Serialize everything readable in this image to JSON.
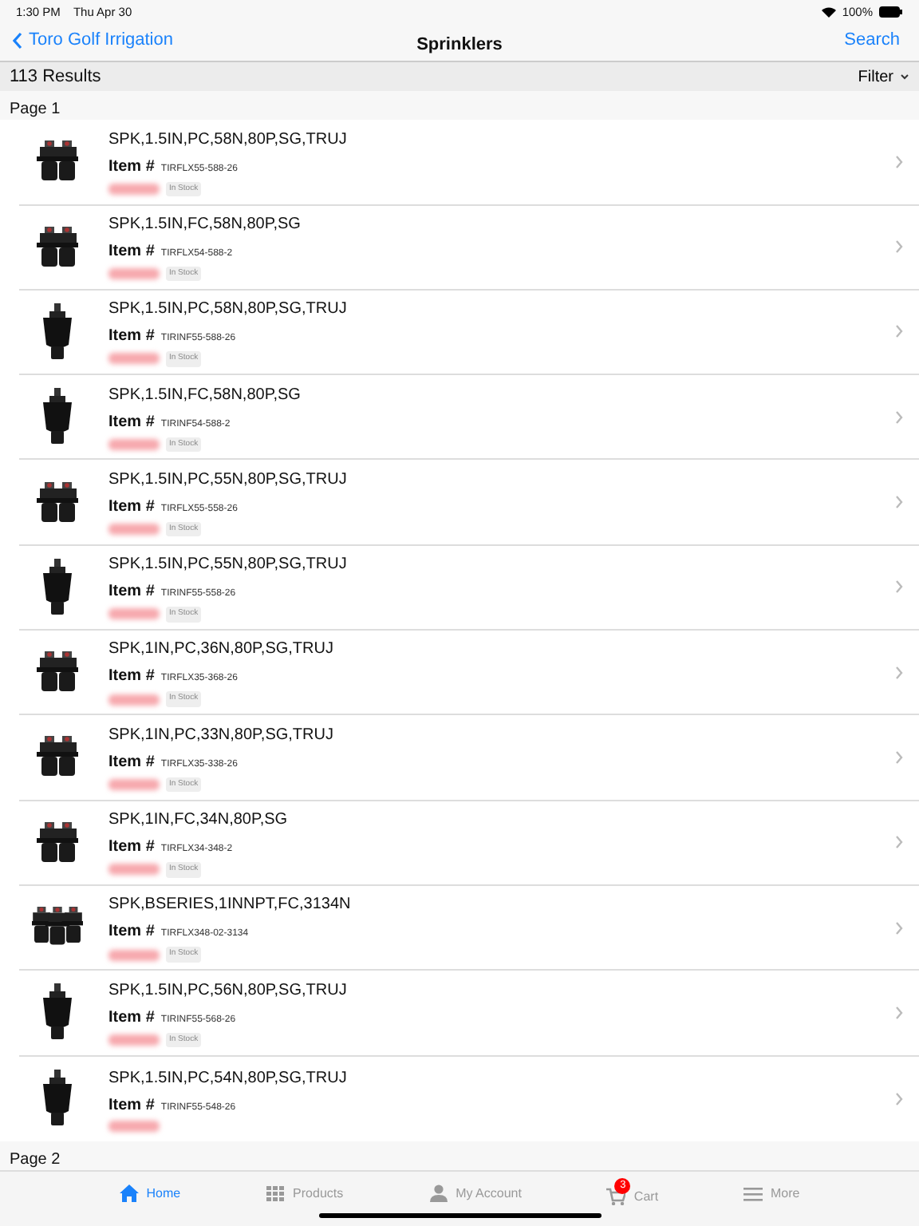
{
  "status_bar": {
    "time": "1:30 PM",
    "date": "Thu Apr 30",
    "battery": "100%"
  },
  "nav": {
    "back": "Toro Golf Irrigation",
    "title": "Sprinklers",
    "action": "Search"
  },
  "results": {
    "count": "113 Results",
    "filter": "Filter"
  },
  "pages": [
    {
      "label": "Page 1",
      "items": [
        {
          "name": "SPK,1.5IN,PC,58N,80P,SG,TRUJ",
          "item_label": "Item #",
          "item_no": "TIRFLX55-588-26",
          "kind": "twin",
          "in_stock": true,
          "stock": "In Stock"
        },
        {
          "name": "SPK,1.5IN,FC,58N,80P,SG",
          "item_label": "Item #",
          "item_no": "TIRFLX54-588-2",
          "kind": "twin",
          "in_stock": true,
          "stock": "In Stock"
        },
        {
          "name": "SPK,1.5IN,PC,58N,80P,SG,TRUJ",
          "item_label": "Item #",
          "item_no": "TIRINF55-588-26",
          "kind": "single",
          "in_stock": true,
          "stock": "In Stock"
        },
        {
          "name": "SPK,1.5IN,FC,58N,80P,SG",
          "item_label": "Item #",
          "item_no": "TIRINF54-588-2",
          "kind": "single",
          "in_stock": true,
          "stock": "In Stock"
        },
        {
          "name": "SPK,1.5IN,PC,55N,80P,SG,TRUJ",
          "item_label": "Item #",
          "item_no": "TIRFLX55-558-26",
          "kind": "twin",
          "in_stock": true,
          "stock": "In Stock"
        },
        {
          "name": "SPK,1.5IN,PC,55N,80P,SG,TRUJ",
          "item_label": "Item #",
          "item_no": "TIRINF55-558-26",
          "kind": "single",
          "in_stock": true,
          "stock": "In Stock"
        },
        {
          "name": "SPK,1IN,PC,36N,80P,SG,TRUJ",
          "item_label": "Item #",
          "item_no": "TIRFLX35-368-26",
          "kind": "twin",
          "in_stock": true,
          "stock": "In Stock"
        },
        {
          "name": "SPK,1IN,PC,33N,80P,SG,TRUJ",
          "item_label": "Item #",
          "item_no": "TIRFLX35-338-26",
          "kind": "twin",
          "in_stock": true,
          "stock": "In Stock"
        },
        {
          "name": "SPK,1IN,FC,34N,80P,SG",
          "item_label": "Item #",
          "item_no": "TIRFLX34-348-2",
          "kind": "twin",
          "in_stock": true,
          "stock": "In Stock"
        },
        {
          "name": "SPK,BSERIES,1INNPT,FC,3134N",
          "item_label": "Item #",
          "item_no": "TIRFLX348-02-3134",
          "kind": "triple",
          "in_stock": true,
          "stock": "In Stock"
        },
        {
          "name": "SPK,1.5IN,PC,56N,80P,SG,TRUJ",
          "item_label": "Item #",
          "item_no": "TIRINF55-568-26",
          "kind": "single",
          "in_stock": true,
          "stock": "In Stock"
        },
        {
          "name": "SPK,1.5IN,PC,54N,80P,SG,TRUJ",
          "item_label": "Item #",
          "item_no": "TIRINF55-548-26",
          "kind": "single",
          "in_stock": false
        }
      ]
    },
    {
      "label": "Page 2"
    }
  ],
  "tabs": [
    {
      "label": "Home",
      "kind": "home",
      "selected": true
    },
    {
      "label": "Products",
      "kind": "grid",
      "selected": false
    },
    {
      "label": "My Account",
      "kind": "person",
      "selected": false
    },
    {
      "label": "Cart",
      "kind": "cart",
      "selected": false,
      "badge": "3"
    },
    {
      "label": "More",
      "kind": "menu",
      "selected": false
    }
  ]
}
